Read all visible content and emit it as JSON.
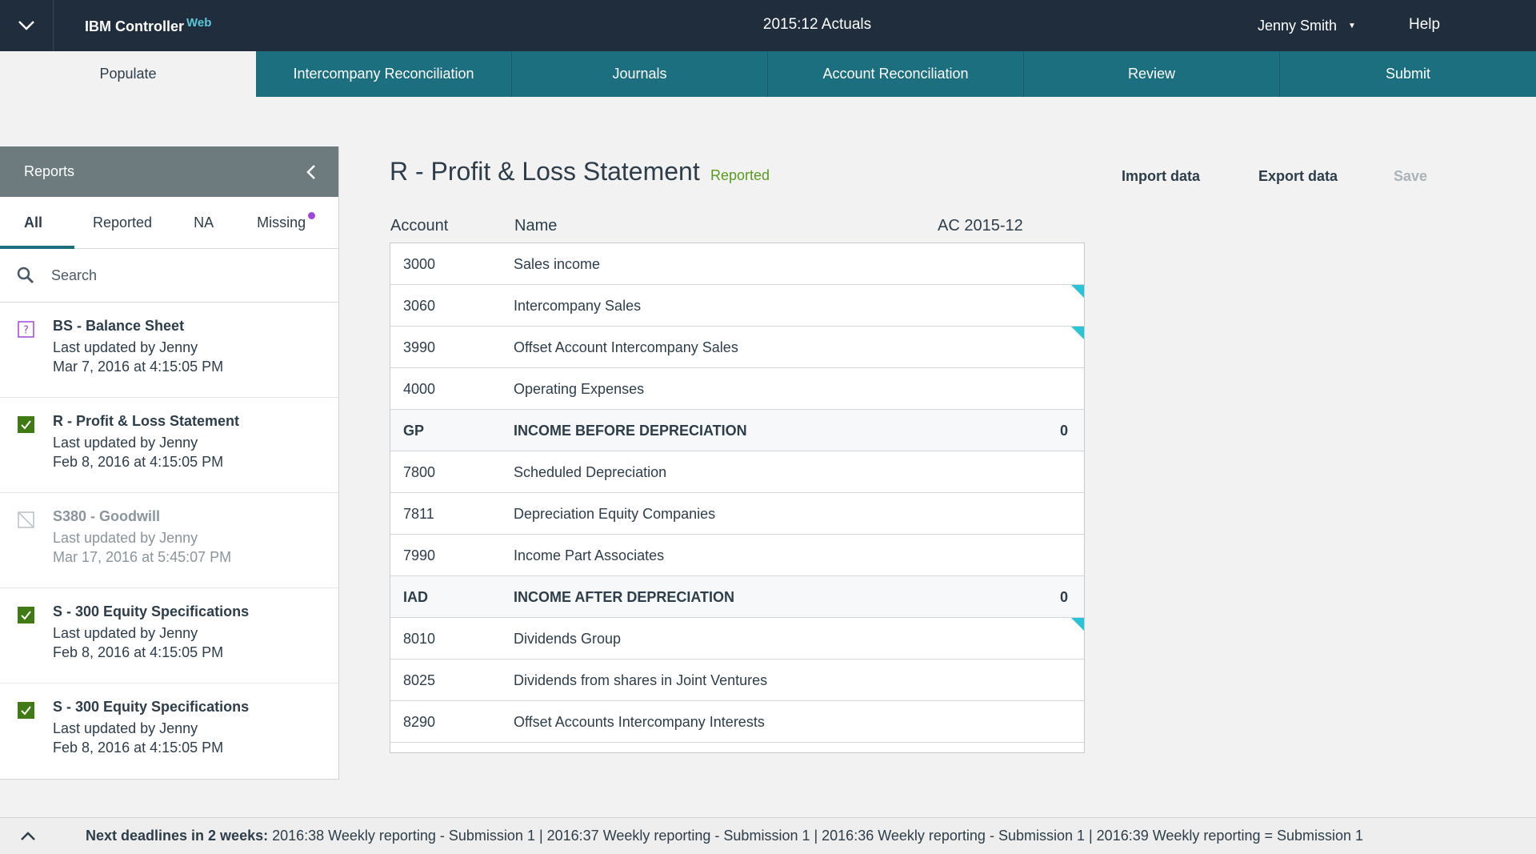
{
  "header": {
    "brand_name": "IBM Controller",
    "brand_suffix": "Web",
    "period": "2015:12 Actuals",
    "user": "Jenny Smith",
    "help": "Help"
  },
  "tabs": [
    {
      "label": "Populate",
      "active": true
    },
    {
      "label": "Intercompany Reconciliation",
      "active": false
    },
    {
      "label": "Journals",
      "active": false
    },
    {
      "label": "Account Reconciliation",
      "active": false
    },
    {
      "label": "Review",
      "active": false
    },
    {
      "label": "Submit",
      "active": false
    }
  ],
  "sidebar": {
    "title": "Reports",
    "filters": [
      {
        "label": "All",
        "active": true
      },
      {
        "label": "Reported",
        "active": false
      },
      {
        "label": "NA",
        "active": false
      },
      {
        "label": "Missing",
        "active": false,
        "has_dot": true
      }
    ],
    "search_placeholder": "Search",
    "reports": [
      {
        "title": "BS - Balance Sheet",
        "updated_by": "Last updated by Jenny",
        "date": "Mar 7, 2016 at 4:15:05 PM",
        "status": "missing-icon"
      },
      {
        "title": "R - Profit & Loss Statement",
        "updated_by": "Last updated by Jenny",
        "date": "Feb 8, 2016 at 4:15:05 PM",
        "status": "checked-icon"
      },
      {
        "title": "S380 - Goodwill",
        "updated_by": "Last updated by Jenny",
        "date": "Mar 17, 2016 at 5:45:07 PM",
        "status": "na-icon"
      },
      {
        "title": "S - 300 Equity Specifications",
        "updated_by": "Last updated by Jenny",
        "date": "Feb 8, 2016 at 4:15:05 PM",
        "status": "checked-icon"
      },
      {
        "title": "S - 300 Equity Specifications",
        "updated_by": "Last updated by Jenny",
        "date": "Feb 8, 2016 at 4:15:05 PM",
        "status": "checked-icon"
      }
    ]
  },
  "main": {
    "title": "R - Profit & Loss Statement",
    "status": "Reported",
    "actions": {
      "import": "Import data",
      "export": "Export data",
      "save": "Save"
    },
    "columns": {
      "account": "Account",
      "name": "Name",
      "value": "AC 2015-12"
    },
    "rows": [
      {
        "account": "3000",
        "name": "Sales income",
        "value": "",
        "subtotal": false,
        "flag": false
      },
      {
        "account": "3060",
        "name": "Intercompany Sales",
        "value": "",
        "subtotal": false,
        "flag": true
      },
      {
        "account": "3990",
        "name": "Offset Account Intercompany Sales",
        "value": "",
        "subtotal": false,
        "flag": true
      },
      {
        "account": "4000",
        "name": "Operating Expenses",
        "value": "",
        "subtotal": false,
        "flag": false
      },
      {
        "account": "GP",
        "name": "INCOME BEFORE DEPRECIATION",
        "value": "0",
        "subtotal": true,
        "flag": false
      },
      {
        "account": "7800",
        "name": "Scheduled Depreciation",
        "value": "",
        "subtotal": false,
        "flag": false
      },
      {
        "account": "7811",
        "name": "Depreciation Equity Companies",
        "value": "",
        "subtotal": false,
        "flag": false
      },
      {
        "account": "7990",
        "name": "Income Part Associates",
        "value": "",
        "subtotal": false,
        "flag": false
      },
      {
        "account": "IAD",
        "name": "INCOME AFTER DEPRECIATION",
        "value": "0",
        "subtotal": true,
        "flag": false
      },
      {
        "account": "8010",
        "name": "Dividends Group",
        "value": "",
        "subtotal": false,
        "flag": true
      },
      {
        "account": "8025",
        "name": "Dividends from shares in Joint Ventures",
        "value": "",
        "subtotal": false,
        "flag": false
      },
      {
        "account": "8290",
        "name": "Offset Accounts Intercompany Interests",
        "value": "",
        "subtotal": false,
        "flag": false
      }
    ]
  },
  "footer": {
    "lead": "Next deadlines in 2 weeks:",
    "deadlines": "2016:38 Weekly reporting - Submission 1  |  2016:37 Weekly reporting - Submission 1  |  2016:36 Weekly reporting - Submission 1  |  2016:39 Weekly reporting = Submission 1"
  },
  "colors": {
    "header_bg": "#1f2d3d",
    "tab_bg": "#1b6f7f",
    "reported_green": "#5a9a1f",
    "check_green": "#3f7a14",
    "missing_purple": "#a046d9",
    "flag_cyan": "#2bc4d6"
  }
}
